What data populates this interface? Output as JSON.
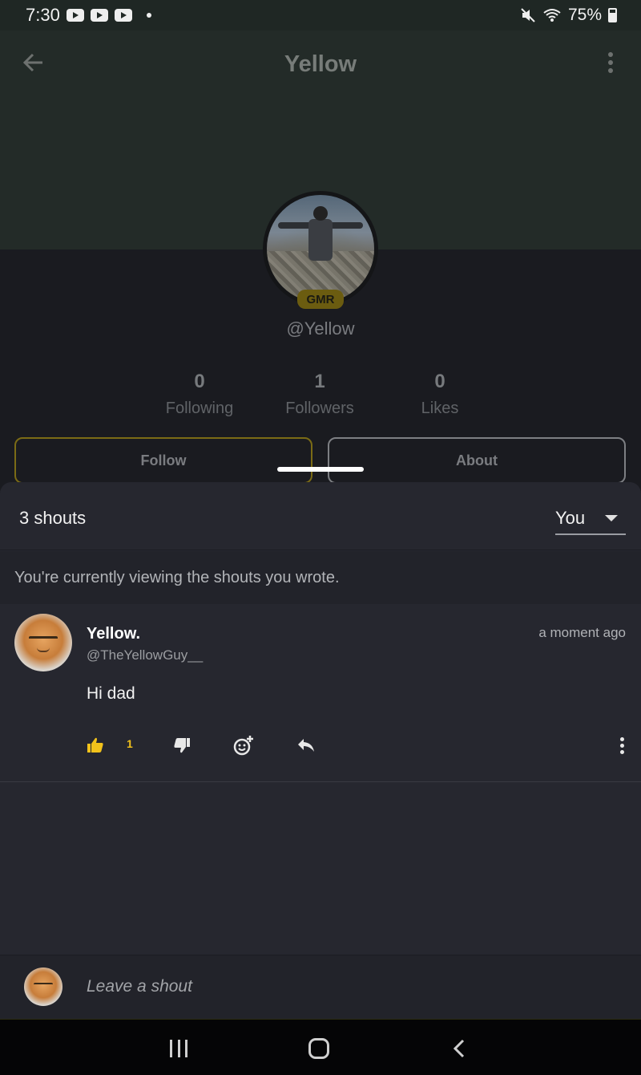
{
  "status_bar": {
    "time": "7:30",
    "battery": "75%"
  },
  "header": {
    "title": "Yellow",
    "back_icon": "arrow-left-icon",
    "menu_icon": "more-vertical-icon"
  },
  "profile": {
    "badge": "GMR",
    "handle": "@Yellow",
    "stats": [
      {
        "value": "0",
        "label": "Following"
      },
      {
        "value": "1",
        "label": "Followers"
      },
      {
        "value": "0",
        "label": "Likes"
      }
    ],
    "follow_label": "Follow",
    "about_label": "About"
  },
  "shouts": {
    "count_label": "3 shouts",
    "filter_value": "You",
    "notice": "You're currently viewing the shouts you wrote.",
    "posts": [
      {
        "name": "Yellow.",
        "handle": "@TheYellowGuy__",
        "time": "a moment ago",
        "text": "Hi dad",
        "likes": "1"
      }
    ],
    "composer_placeholder": "Leave a shout"
  },
  "colors": {
    "accent": "#f2c21b",
    "follow_border": "#7b6b15",
    "sheet_bg": "#26272f"
  }
}
